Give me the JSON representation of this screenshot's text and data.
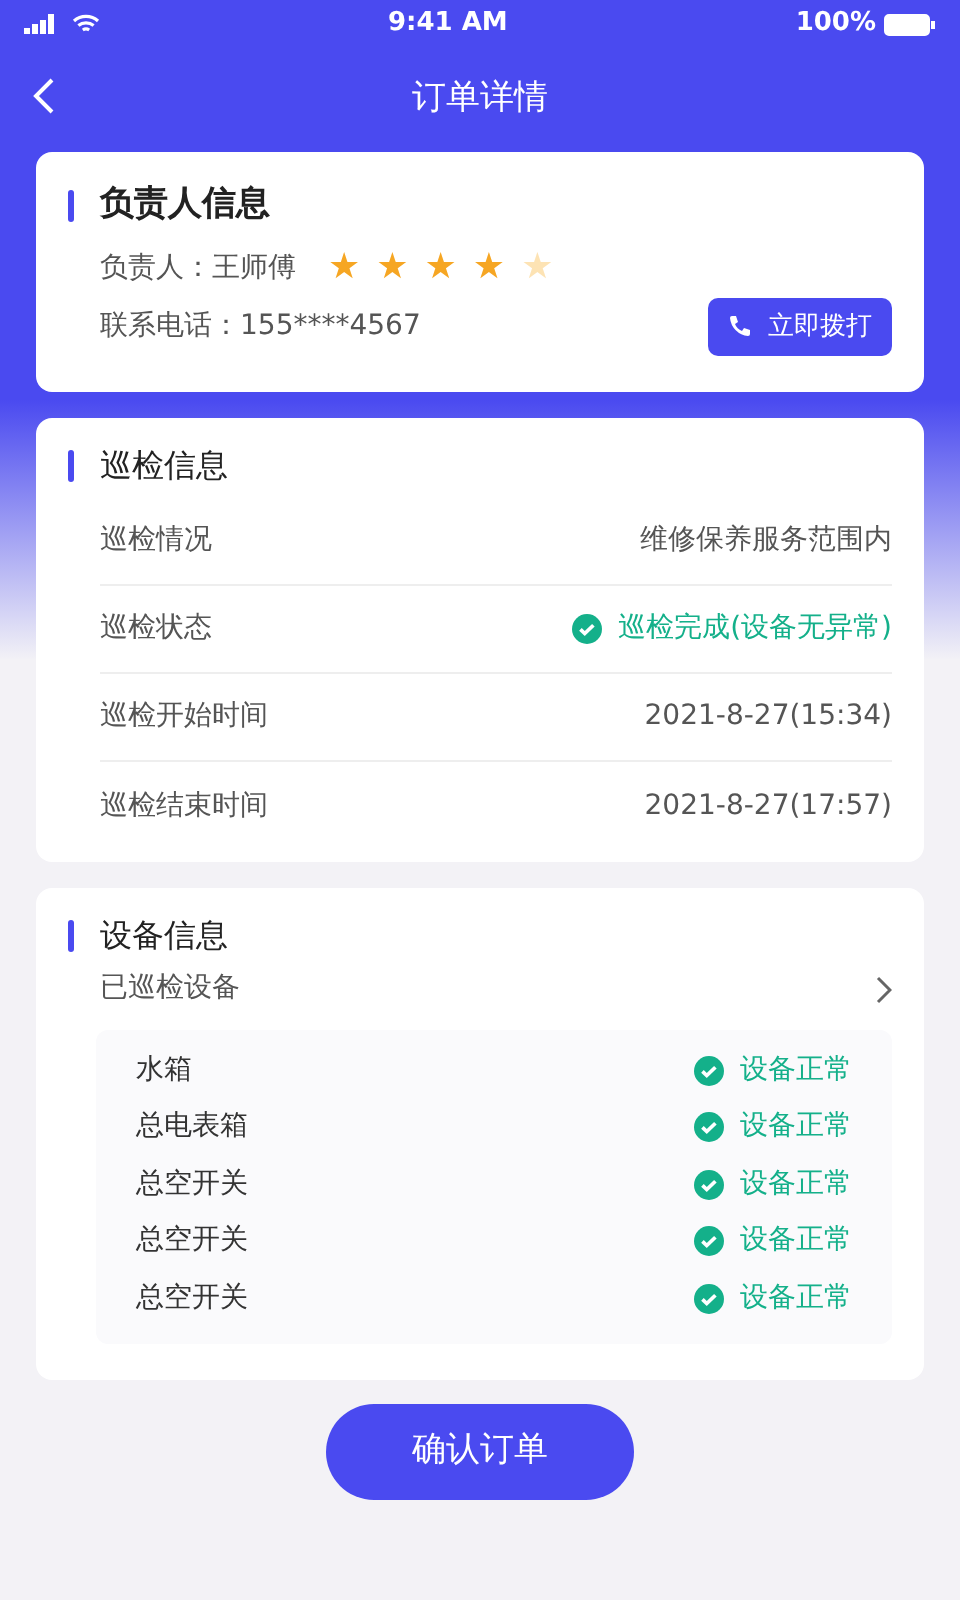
{
  "status_bar": {
    "time": "9:41 AM",
    "battery": "100%"
  },
  "header": {
    "title": "订单详情"
  },
  "person": {
    "title": "负责人信息",
    "name_label": "负责人：",
    "name": "王师傅",
    "stars": 4,
    "phone_label": "联系电话：",
    "phone": "155****4567",
    "call_button": "立即拨打"
  },
  "inspection": {
    "title": "巡检信息",
    "rows": [
      {
        "label": "巡检情况",
        "value": "维修保养服务范围内",
        "kind": "text"
      },
      {
        "label": "巡检状态",
        "value": "巡检完成(设备无异常)",
        "kind": "status"
      },
      {
        "label": "巡检开始时间",
        "value": "2021-8-27(15:34)",
        "kind": "text"
      },
      {
        "label": "巡检结束时间",
        "value": "2021-8-27(17:57)",
        "kind": "text"
      }
    ]
  },
  "devices": {
    "title": "设备信息",
    "link": "已巡检设备",
    "items": [
      {
        "name": "水箱",
        "status": "设备正常"
      },
      {
        "name": "总电表箱",
        "status": "设备正常"
      },
      {
        "name": "总空开关",
        "status": "设备正常"
      },
      {
        "name": "总空开关",
        "status": "设备正常"
      },
      {
        "name": "总空开关",
        "status": "设备正常"
      }
    ]
  },
  "confirm_button": "确认订单"
}
